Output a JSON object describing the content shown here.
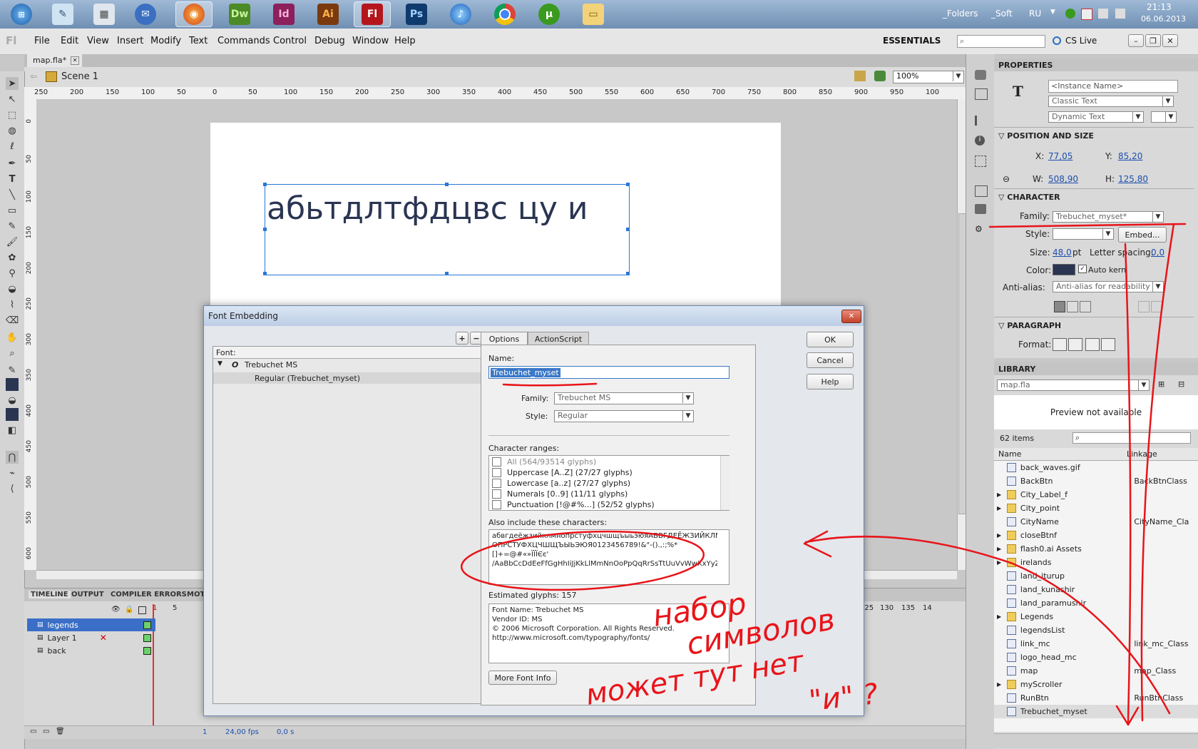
{
  "taskbar": {
    "apps": [
      {
        "name": "start-orb",
        "label": ""
      },
      {
        "name": "notepad",
        "label": ""
      },
      {
        "name": "calculator",
        "label": ""
      },
      {
        "name": "thunderbird",
        "label": ""
      },
      {
        "name": "firefox",
        "label": ""
      },
      {
        "name": "dreamweaver",
        "label": "Dw"
      },
      {
        "name": "indesign",
        "label": "Id"
      },
      {
        "name": "illustrator",
        "label": "Ai"
      },
      {
        "name": "flash",
        "label": "Fl"
      },
      {
        "name": "photoshop",
        "label": "Ps"
      },
      {
        "name": "itunes",
        "label": ""
      },
      {
        "name": "chrome",
        "label": ""
      },
      {
        "name": "utorrent",
        "label": ""
      },
      {
        "name": "explorer",
        "label": ""
      }
    ],
    "tray": {
      "folders": "_Folders",
      "soft": "_Soft",
      "lang": "RU",
      "time": "21:13",
      "date": "06.06.2013"
    }
  },
  "menubar": {
    "logo": "Fl",
    "items": [
      "File",
      "Edit",
      "View",
      "Insert",
      "Modify",
      "Text",
      "Commands",
      "Control",
      "Debug",
      "Window",
      "Help"
    ],
    "workspace": "ESSENTIALS",
    "cslive": "CS Live"
  },
  "document": {
    "tab": "map.fla*",
    "scene": "Scene 1",
    "zoom": "100%"
  },
  "ruler_h": [
    "250",
    "200",
    "150",
    "100",
    "50",
    "0",
    "50",
    "100",
    "150",
    "200",
    "250",
    "300",
    "350",
    "400",
    "450",
    "500",
    "550",
    "600",
    "650",
    "700",
    "750",
    "800",
    "850",
    "900",
    "950",
    "100"
  ],
  "ruler_v": [
    "0",
    "50",
    "100",
    "150",
    "200",
    "250",
    "300",
    "350",
    "400",
    "450",
    "500",
    "550",
    "600"
  ],
  "stage": {
    "text": "абьтдлтфдцвс цу и"
  },
  "timeline": {
    "tabs": [
      "TIMELINE",
      "OUTPUT",
      "COMPILER ERRORS",
      "MOT"
    ],
    "frame_numbers": [
      "1",
      "5"
    ],
    "frame_numbers_right": [
      "125",
      "130",
      "135",
      "14"
    ],
    "layers": [
      "legends",
      "Layer 1",
      "back"
    ],
    "footer": {
      "frame": "1",
      "fps": "24,00 fps",
      "time": "0,0 s"
    }
  },
  "properties": {
    "title": "PROPERTIES",
    "instance_name": "<Instance Name>",
    "text_engine": "Classic Text",
    "text_type": "Dynamic Text",
    "sections": {
      "pos": "POSITION AND SIZE",
      "char": "CHARACTER",
      "para": "PARAGRAPH"
    },
    "x_label": "X:",
    "x": "77,05",
    "y_label": "Y:",
    "y": "85,20",
    "w_label": "W:",
    "w": "508,90",
    "h_label": "H:",
    "h": "125,80",
    "family_label": "Family:",
    "family": "Trebuchet_myset*",
    "style_label": "Style:",
    "embed": "Embed...",
    "size_label": "Size:",
    "size": "48,0",
    "size_unit": "pt",
    "spacing_label": "Letter spacing:",
    "spacing": "0,0",
    "color_label": "Color:",
    "autokern": "Auto kern",
    "antialias_label": "Anti-alias:",
    "antialias": "Anti-alias for readability",
    "format_label": "Format:",
    "color_value": "#2a3552"
  },
  "library": {
    "title": "LIBRARY",
    "file": "map.fla",
    "preview": "Preview not available",
    "count": "62 items",
    "col_name": "Name",
    "col_linkage": "Linkage",
    "items": [
      {
        "name": "back_waves.gif",
        "linkage": "",
        "folder": false,
        "expand": ""
      },
      {
        "name": "BackBtn",
        "linkage": "BackBtnClass",
        "folder": false,
        "expand": ""
      },
      {
        "name": "City_Label_f",
        "linkage": "",
        "folder": true,
        "expand": "▶"
      },
      {
        "name": "City_point",
        "linkage": "",
        "folder": true,
        "expand": "▶"
      },
      {
        "name": "CityName",
        "linkage": "CityName_Cla",
        "folder": false,
        "expand": ""
      },
      {
        "name": "closeBtnf",
        "linkage": "",
        "folder": true,
        "expand": "▶"
      },
      {
        "name": "flash0.ai Assets",
        "linkage": "",
        "folder": true,
        "expand": "▶"
      },
      {
        "name": "irelands",
        "linkage": "",
        "folder": true,
        "expand": "▶"
      },
      {
        "name": "land_iturup",
        "linkage": "",
        "folder": false,
        "expand": ""
      },
      {
        "name": "land_kunashir",
        "linkage": "",
        "folder": false,
        "expand": ""
      },
      {
        "name": "land_paramushir",
        "linkage": "",
        "folder": false,
        "expand": ""
      },
      {
        "name": "Legends",
        "linkage": "",
        "folder": true,
        "expand": "▶"
      },
      {
        "name": "legendsList",
        "linkage": "",
        "folder": false,
        "expand": ""
      },
      {
        "name": "link_mc",
        "linkage": "link_mc_Class",
        "folder": false,
        "expand": ""
      },
      {
        "name": "logo_head_mc",
        "linkage": "",
        "folder": false,
        "expand": ""
      },
      {
        "name": "map",
        "linkage": "map_Class",
        "folder": false,
        "expand": ""
      },
      {
        "name": "myScroller",
        "linkage": "",
        "folder": true,
        "expand": "▶"
      },
      {
        "name": "RunBtn",
        "linkage": "RunBtnClass",
        "folder": false,
        "expand": ""
      },
      {
        "name": "Trebuchet_myset",
        "linkage": "",
        "folder": false,
        "expand": ""
      }
    ]
  },
  "dialog": {
    "title": "Font Embedding",
    "font_header": "Font:",
    "font_family": "Trebuchet MS",
    "font_style": "Regular (Trebuchet_myset)",
    "tabs": [
      "Options",
      "ActionScript"
    ],
    "name_label": "Name:",
    "name_value": "Trebuchet_myset",
    "family_label": "Family:",
    "family_value": "Trebuchet MS",
    "style_label": "Style:",
    "style_value": "Regular",
    "ranges_label": "Character ranges:",
    "ranges": [
      "All  (564/93514 glyphs)",
      "Uppercase [A..Z]  (27/27 glyphs)",
      "Lowercase [a..z]  (27/27 glyphs)",
      "Numerals [0..9]  (11/11 glyphs)",
      "Punctuation [!@#%...]  (52/52 glyphs)"
    ],
    "also_label": "Also include these characters:",
    "also_chars": [
      "абвгдеёжзийклмнопрстуфхцчшщъыьэюяАБВГДЕЁЖЗИЙКЛМН",
      "ОПРСТУФХЦЧШЩЪЫЬЭЮЯ0123456789!&\"-().,:;%*",
      "[]+=@#«»ÏÏÏЄє'",
      "/AaBbCcDdEeFfGgHhIiJjKkLlMmNnOoPpQqRrSsTtUuVvWwXxYyZz"
    ],
    "estimated": "Estimated glyphs: 157",
    "info": [
      "Font Name: Trebuchet MS",
      "Vendor ID: MS",
      "© 2006 Microsoft Corporation. All Rights Reserved.",
      "http://www.microsoft.com/typography/fonts/"
    ],
    "more_info": "More Font Info",
    "ok": "OK",
    "cancel": "Cancel",
    "help": "Help"
  },
  "annotation": {
    "line1": "набор",
    "line2": "символов",
    "line3": "может тут нет",
    "line4": "\"и\" ?"
  }
}
